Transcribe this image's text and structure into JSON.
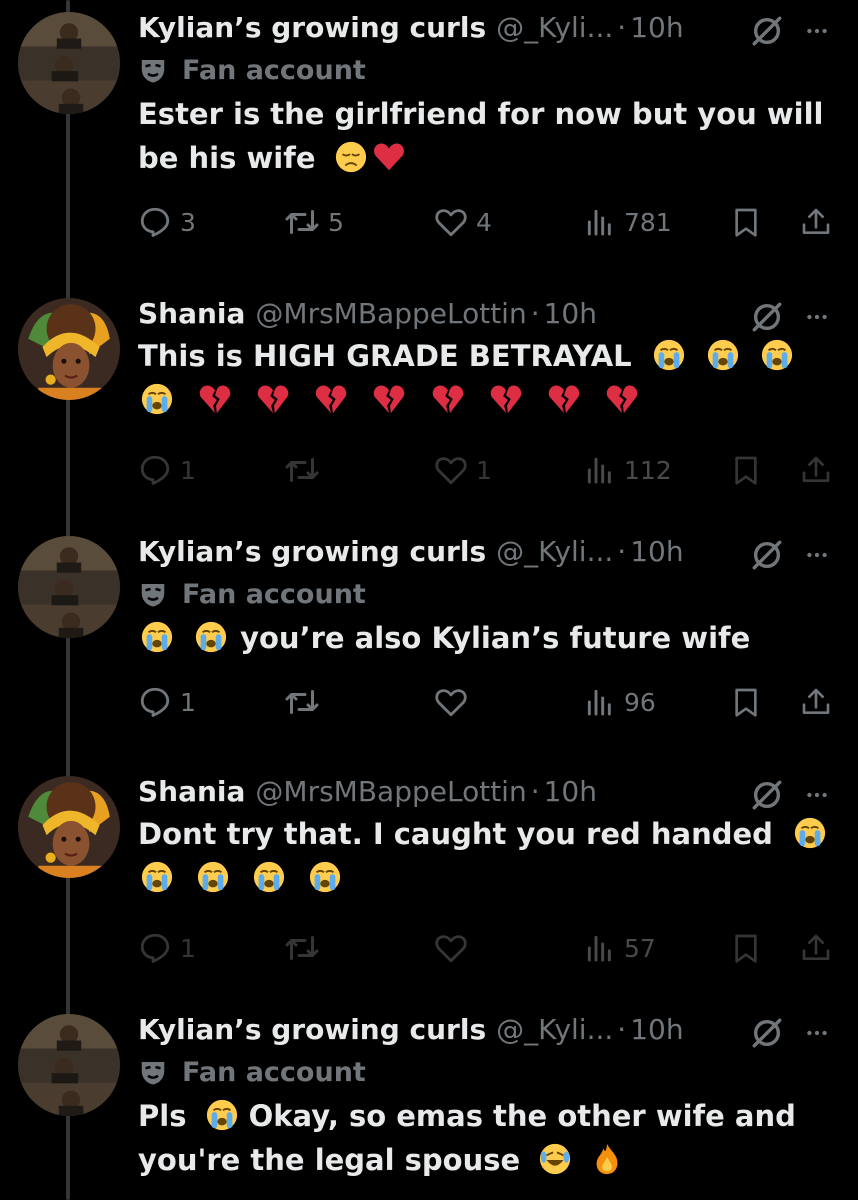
{
  "tweets": [
    {
      "avatar": "kylian-avatar",
      "name": "Kylian’s growing curls",
      "handle": "@_Kyli...",
      "separator": "·",
      "time": "10h",
      "label": "Fan account",
      "lines": [
        "Ester is the girlfriend for now but you will",
        "be his wife"
      ],
      "replies": "3",
      "reposts": "5",
      "likes": "4",
      "views": "781"
    },
    {
      "avatar": "shania-avatar",
      "name": "Shania",
      "handle": "@MrsMBappeLottin",
      "separator": "·",
      "time": "10h",
      "lines": [
        "This is HIGH GRADE BETRAYAL"
      ],
      "replies": "1",
      "reposts": "",
      "likes": "1",
      "views": "112"
    },
    {
      "avatar": "kylian-avatar",
      "name": "Kylian’s growing curls",
      "handle": "@_Kyli...",
      "separator": "·",
      "time": "10h",
      "label": "Fan account",
      "lines": [
        "you’re also Kylian’s future wife"
      ],
      "replies": "1",
      "reposts": "",
      "likes": "",
      "views": "96"
    },
    {
      "avatar": "shania-avatar",
      "name": "Shania",
      "handle": "@MrsMBappeLottin",
      "separator": "·",
      "time": "10h",
      "lines": [
        "Dont try that. I caught you red handed"
      ],
      "replies": "1",
      "reposts": "",
      "likes": "",
      "views": "57"
    },
    {
      "avatar": "kylian-avatar",
      "name": "Kylian’s growing curls",
      "handle": "@_Kyli...",
      "separator": "·",
      "time": "10h",
      "label": "Fan account",
      "lines": [
        "Pls",
        "Okay, so emas the other wife and",
        "you're the legal spouse"
      ]
    }
  ],
  "colors": {
    "background": "#000000",
    "primary_text": "#e7e9ea",
    "secondary_text": "#71767b",
    "thread_line": "#333639"
  }
}
